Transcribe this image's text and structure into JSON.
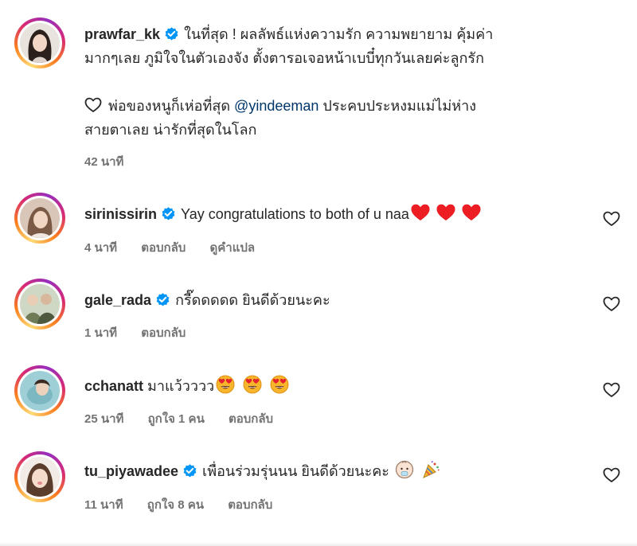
{
  "caption": {
    "username": "prawfar_kk",
    "text_line1": "ในที่สุด ! ผลลัพธ์แห่งความรัก ความพยายาม คุ้มค่า",
    "text_line2": "มากๆเลย ภูมิใจในตัวเองจัง ตั้งตารอเจอหน้าเบบี๋ทุกวันเลยค่ะลูกรัก",
    "text_line3_prefix": "พ่อของหนูก็เห่อที่สุด",
    "mention": "@yindeeman",
    "text_line3_suffix": "ประคบประหงมแม่ไม่ห่าง",
    "text_line4": "สายตาเลย น่ารักที่สุดในโลก",
    "time": "42 นาที"
  },
  "comments": [
    {
      "username": "sirinissirin",
      "verified": true,
      "text": "Yay congratulations to both of u naa",
      "emoji": "red-heart x3",
      "time": "4 นาที",
      "reply_label": "ตอบกลับ",
      "translate_label": "ดูคำแปล"
    },
    {
      "username": "gale_rada",
      "verified": true,
      "text": "กรี๊ดดดดด ยินดีด้วยนะคะ",
      "time": "1 นาที",
      "reply_label": "ตอบกลับ"
    },
    {
      "username": "cchanatt",
      "verified": false,
      "text": "มาแว้วววว",
      "emoji": "heart-eyes x3",
      "time": "25 นาที",
      "likes_label": "ถูกใจ 1 คน",
      "reply_label": "ตอบกลับ"
    },
    {
      "username": "tu_piyawadee",
      "verified": true,
      "text": "เพื่อนร่วมรุ่นนน ยินดีด้วยนะคะ",
      "emoji": "baby + party-popper",
      "time": "11 นาที",
      "likes_label": "ถูกใจ 8 คน",
      "reply_label": "ตอบกลับ"
    }
  ],
  "colors": {
    "verified_blue": "#0095f6",
    "mention": "#00376b",
    "meta_gray": "#737373",
    "heart_red": "#ed1d24"
  },
  "icons": [
    "verified-badge-icon",
    "heart-outline-icon",
    "like-heart-icon"
  ]
}
